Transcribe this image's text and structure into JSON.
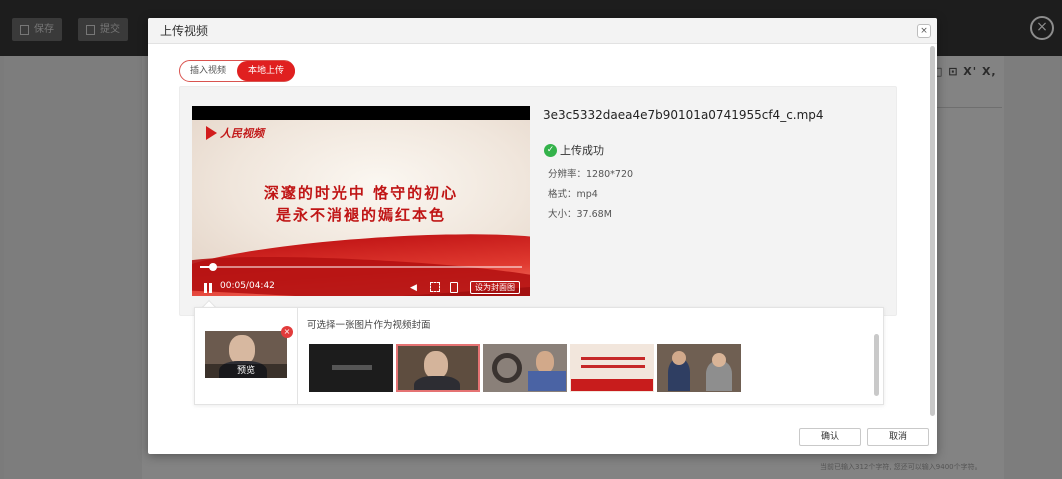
{
  "app": {
    "save_label": "保存",
    "submit_label": "提交",
    "editor_tools": "□ ⊡ X' X,",
    "word_count": "当前已输入312个字符, 您还可以输入9400个字符。"
  },
  "modal": {
    "title": "上传视频",
    "close_label": "×",
    "tabs": [
      {
        "label": "插入视频",
        "active": false
      },
      {
        "label": "本地上传",
        "active": true
      }
    ],
    "player": {
      "logo_text": "人民视频",
      "frame_line1": "深邃的时光中 恪守的初心",
      "frame_line2": "是永不消褪的嫣红本色",
      "time": "00:05/04:42",
      "progress": 0.04,
      "set_cover_label": "设为封面图"
    },
    "file": {
      "name": "3e3c5332daea4e7b90101a0741955cf4_c.mp4",
      "status": "上传成功",
      "resolution": "分辨率：1280*720",
      "format": "格式：mp4",
      "size": "大小：37.68M"
    },
    "cover": {
      "hint": "可选择一张图片作为视频封面",
      "preview_label": "预览",
      "remove_label": "×",
      "selected_index": 1,
      "thumbnails": [
        {
          "name": "thumb-dark-title"
        },
        {
          "name": "thumb-speaker"
        },
        {
          "name": "thumb-film-reel"
        },
        {
          "name": "thumb-red-title"
        },
        {
          "name": "thumb-two-people"
        }
      ]
    },
    "footer": {
      "confirm_label": "确认",
      "cancel_label": "取消"
    }
  },
  "colors": {
    "accent_red": "#e02020",
    "success_green": "#33b24a"
  }
}
